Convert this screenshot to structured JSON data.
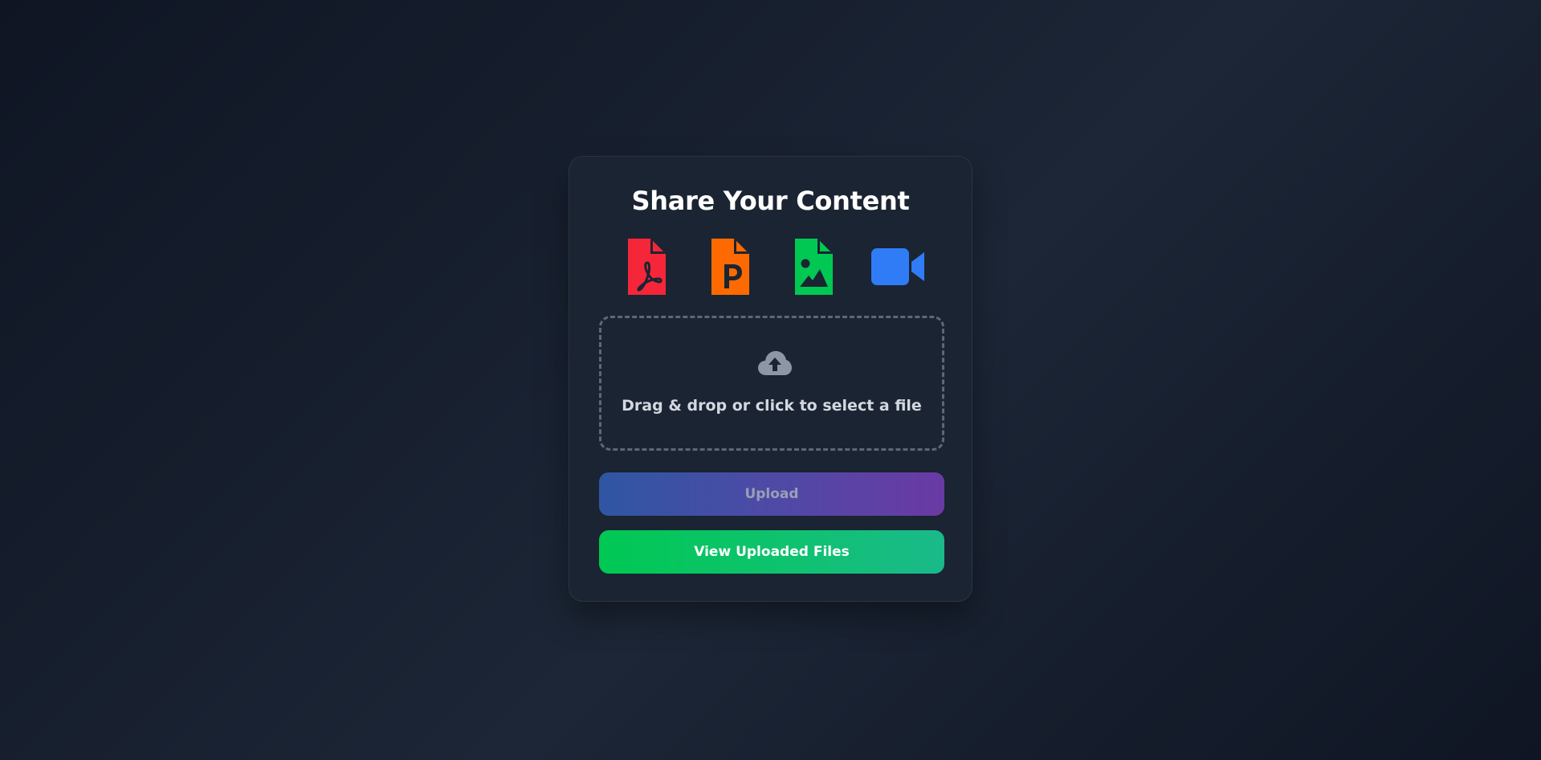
{
  "card": {
    "title": "Share Your Content"
  },
  "file_types": [
    {
      "name": "pdf-file-icon",
      "color": "#f5263a"
    },
    {
      "name": "powerpoint-file-icon",
      "color": "#ff6a00"
    },
    {
      "name": "image-file-icon",
      "color": "#00c853"
    },
    {
      "name": "video-camera-icon",
      "color": "#2f7cf6"
    }
  ],
  "dropzone": {
    "icon": "cloud-upload-icon",
    "text": "Drag & drop or click to select a file"
  },
  "buttons": {
    "upload_label": "Upload",
    "view_label": "View Uploaded Files"
  },
  "colors": {
    "background": "#131a27",
    "card": "#1b2432",
    "upload_gradient_start": "#2f56a3",
    "upload_gradient_end": "#6a3aa4",
    "view_gradient_start": "#00c853",
    "view_gradient_end": "#1ab98a"
  }
}
